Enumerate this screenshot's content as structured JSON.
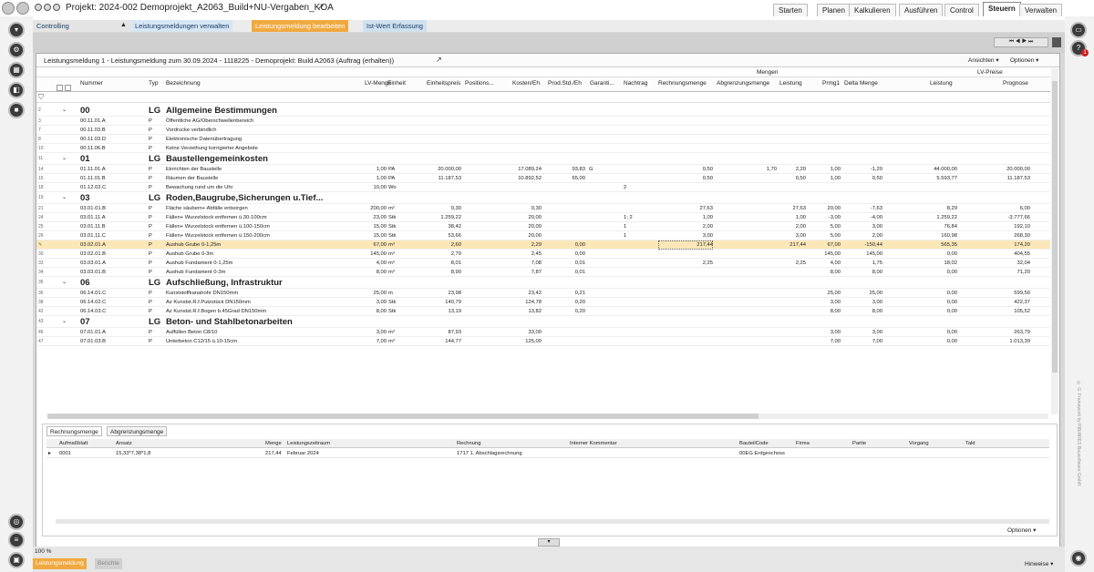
{
  "window": {
    "title": "Projekt: 2024-002 Demoprojekt_A2063_Build+NU-Vergaben_KOA"
  },
  "topnav": [
    "Starten",
    "Planen",
    "Kalkulieren",
    "Ausführen",
    "Control",
    "Steuern",
    "Verwalten"
  ],
  "breadcrumb": {
    "controlling": "Controlling",
    "lm_verwalten": "Leistungsmeldungen verwalten",
    "lm_bearbeiten": "Leistungsmeldung bearbeiten",
    "istwert": "Ist-Wert Erfassung"
  },
  "panel": {
    "title": "Leistungsmeldung 1 - Leistungsmeldung zum 30.09.2024 - 1118225 - Demoprojekt: Build A2063 (Auftrag (erhalten))",
    "ansichten": "Ansichten ▾",
    "optionen": "Optionen ▾",
    "group_mengen": "Mengen",
    "group_lvpreise": "LV-Preise"
  },
  "columns": {
    "nummer": "Nummer",
    "typ": "Typ",
    "bezeichnung": "Bezeichnung",
    "lvmenge": "LV-Menge",
    "einheit": "Einheit",
    "ep": "Einheitspreis",
    "pos": "Positions...",
    "kosten": "Kosten/Eh",
    "prod": "Prod.Std./Eh",
    "garant": "Garanti...",
    "nachtrag": "Nachtrag",
    "rechmenge": "Rechnungsmenge",
    "abgrenz": "Abgrenzungsmenge",
    "leistung": "Leistung",
    "prmg": "Prmg1",
    "delta": "Delta Menge",
    "lv_leistung": "Leistung",
    "prognose": "Prognose"
  },
  "rows": [
    {
      "rn": "2",
      "grp": true,
      "nr": "00",
      "typ": "LG",
      "bez": "Allgemeine Bestimmungen"
    },
    {
      "rn": "3",
      "nr": "00.11.01.A",
      "typ": "P",
      "bez": "Öffentliche AG/Oberschwellenbereich"
    },
    {
      "rn": "7",
      "nr": "00.11.03.B",
      "typ": "P",
      "bez": "Vordrucke verbindlich"
    },
    {
      "rn": "8",
      "nr": "00.11.03.D",
      "typ": "P",
      "bez": "Elektronische Datenübertragung"
    },
    {
      "rn": "10",
      "nr": "00.11.06.B",
      "typ": "P",
      "bez": "Keine Verzeihung korrigierter Angebote"
    },
    {
      "rn": "11",
      "grp": true,
      "nr": "01",
      "typ": "LG",
      "bez": "Baustellengemeinkosten"
    },
    {
      "rn": "14",
      "nr": "01.11.01.A",
      "typ": "P",
      "bez": "Einrichten der Baustelle",
      "lvm": "1,00",
      "eh": "PA",
      "ep": "20.000,00",
      "ko": "17.089,24",
      "pr": "93,83",
      "ga": "G",
      "rm": "0,50",
      "am": "1,70",
      "le": "2,20",
      "pm": "1,00",
      "dm": "-1,20",
      "lvl": "44.000,00",
      "pg": "20.000,00"
    },
    {
      "rn": "15",
      "nr": "01.11.01.B",
      "typ": "P",
      "bez": "Räumen der Baustelle",
      "lvm": "1,00",
      "eh": "PA",
      "ep": "11.187,53",
      "ko": "10.892,52",
      "pr": "65,00",
      "rm": "0,50",
      "le": "0,50",
      "pm": "1,00",
      "dm": "0,50",
      "lvl": "5.593,77",
      "pg": "11.187,53"
    },
    {
      "rn": "18",
      "nr": "01.12.02.C",
      "typ": "P",
      "bez": "Bewachung rund um die Uhr",
      "lvm": "10,00",
      "eh": "Wo",
      "na": "2"
    },
    {
      "rn": "19",
      "grp": true,
      "nr": "03",
      "typ": "LG",
      "bez": "Roden,Baugrube,Sicherungen u.Tief..."
    },
    {
      "rn": "21",
      "nr": "03.01.01.B",
      "typ": "P",
      "bez": "Fläche säubern+ Abfälle entsorgen",
      "lvm": "200,00",
      "eh": "m²",
      "ep": "0,30",
      "ko": "0,30",
      "rm": "27,63",
      "le": "27,63",
      "pm": "20,00",
      "dm": "-7,63",
      "lvl": "8,29",
      "pg": "6,00"
    },
    {
      "rn": "24",
      "nr": "03.01.11.A",
      "typ": "P",
      "bez": "Fällen+ Wurzelstock entfernen ü.30-100cm",
      "lvm": "23,00",
      "eh": "Stk",
      "ep": "1.259,22",
      "ko": "20,00",
      "na": "1; 2",
      "rm": "1,00",
      "le": "1,00",
      "pm": "-3,00",
      "dm": "-4,00",
      "lvl": "1.259,22",
      "pg": "-3.777,66"
    },
    {
      "rn": "25",
      "nr": "03.01.11.B",
      "typ": "P",
      "bez": "Fällen+ Wurzelstock entfernen ü.100-150cm",
      "lvm": "15,00",
      "eh": "Stk",
      "ep": "38,42",
      "ko": "20,00",
      "na": "1",
      "rm": "2,00",
      "le": "2,00",
      "pm": "5,00",
      "dm": "3,00",
      "lvl": "76,84",
      "pg": "192,10"
    },
    {
      "rn": "26",
      "nr": "03.01.11.C",
      "typ": "P",
      "bez": "Fällen+ Wurzelstock entfernen ü.150-200cm",
      "lvm": "15,00",
      "eh": "Stk",
      "ep": "53,66",
      "ko": "20,00",
      "na": "1",
      "rm": "3,00",
      "le": "3,00",
      "pm": "5,00",
      "dm": "2,00",
      "lvl": "160,98",
      "pg": "268,30"
    },
    {
      "rn": "✎",
      "sel": true,
      "nr": "03.02.01.A",
      "typ": "P",
      "bez": "Aushub Grube 0-1,25m",
      "lvm": "67,00",
      "eh": "m³",
      "ep": "2,60",
      "ko": "2,29",
      "pr": "0,00",
      "rm": "217,44",
      "le": "217,44",
      "pm": "67,00",
      "dm": "-150,44",
      "lvl": "565,35",
      "pg": "174,20"
    },
    {
      "rn": "30",
      "nr": "03.02.01.B",
      "typ": "P",
      "bez": "Aushub Grube 0-3m",
      "lvm": "145,00",
      "eh": "m³",
      "ep": "2,79",
      "ko": "2,45",
      "pr": "0,00",
      "pm": "145,00",
      "dm": "145,00",
      "lvl": "0,00",
      "pg": "404,55"
    },
    {
      "rn": "33",
      "nr": "03.03.01.A",
      "typ": "P",
      "bez": "Aushub Fundament 0-1,25m",
      "lvm": "4,00",
      "eh": "m³",
      "ep": "8,01",
      "ko": "7,08",
      "pr": "0,01",
      "rm": "2,25",
      "le": "2,25",
      "pm": "4,00",
      "dm": "1,75",
      "lvl": "18,02",
      "pg": "32,04"
    },
    {
      "rn": "34",
      "nr": "03.03.01.B",
      "typ": "P",
      "bez": "Aushub Fundament 0-3m",
      "lvm": "8,00",
      "eh": "m³",
      "ep": "8,90",
      "ko": "7,87",
      "pr": "0,01",
      "pm": "8,00",
      "dm": "8,00",
      "lvl": "0,00",
      "pg": "71,20"
    },
    {
      "rn": "35",
      "grp": true,
      "nr": "06",
      "typ": "LG",
      "bez": "Aufschließung, Infrastruktur"
    },
    {
      "rn": "36",
      "nr": "06.14.01.C",
      "typ": "P",
      "bez": "Kunststoffkanalrohr DN150mm",
      "lvm": "25,00",
      "eh": "m",
      "ep": "23,98",
      "ko": "23,42",
      "pr": "0,21",
      "pm": "25,00",
      "dm": "25,00",
      "lvl": "0,00",
      "pg": "599,50"
    },
    {
      "rn": "38",
      "nr": "06.14.02.C",
      "typ": "P",
      "bez": "Az Kunstst.R.f.Putzstück DN150mm",
      "lvm": "3,00",
      "eh": "Stk",
      "ep": "140,79",
      "ko": "124,78",
      "pr": "0,20",
      "pm": "3,00",
      "dm": "3,00",
      "lvl": "0,00",
      "pg": "422,37"
    },
    {
      "rn": "42",
      "nr": "06.14.03.C",
      "typ": "P",
      "bez": "Az Kunstst.R.f.Bogen b.45Grad DN150mm",
      "lvm": "8,00",
      "eh": "Stk",
      "ep": "13,19",
      "ko": "13,82",
      "pr": "0,20",
      "pm": "8,00",
      "dm": "8,00",
      "lvl": "0,00",
      "pg": "105,52"
    },
    {
      "rn": "43",
      "grp": true,
      "nr": "07",
      "typ": "LG",
      "bez": "Beton- und Stahlbetonarbeiten"
    },
    {
      "rn": "46",
      "nr": "07.01.01.A",
      "typ": "P",
      "bez": "Auffüllen Beton C8/10",
      "lvm": "3,00",
      "eh": "m³",
      "ep": "87,93",
      "ko": "33,00",
      "pm": "3,00",
      "dm": "3,00",
      "lvl": "0,00",
      "pg": "263,79"
    },
    {
      "rn": "47",
      "nr": "07.01.03.B",
      "typ": "P",
      "bez": "Unterbeton C12/15 ü.10-15cm",
      "lvm": "7,00",
      "eh": "m³",
      "ep": "144,77",
      "ko": "125,00",
      "pm": "7,00",
      "dm": "7,00",
      "lvl": "0,00",
      "pg": "1.013,39"
    }
  ],
  "bottom": {
    "tabs": [
      "Rechnungsmenge",
      "Abgrenzungsmenge"
    ],
    "headers": [
      "Aufmaßblatt",
      "Ansatz",
      "Menge",
      "Leistungszeitraum",
      "Rechnung",
      "Interner Kommentar",
      "BauteilCode",
      "Firma",
      "Partie",
      "Vorgang",
      "Takt"
    ],
    "row": [
      "0001",
      "15,33*7,38*1,8",
      "217,44",
      "Februar 2024",
      "1717 1. Abschlagsrechnung",
      "",
      "00EG Erdgeschoss",
      "",
      "",
      "",
      ""
    ],
    "optionen": "Optionen ▾"
  },
  "status": {
    "zoom": "100 %",
    "tab_leistung": "Leistungsmeldung",
    "tab_berichte": "Berichte",
    "hinweise": "Hinweise ▾"
  },
  "side_text": "© G. Framework by RIB/ARES Bausoftware GmbH"
}
